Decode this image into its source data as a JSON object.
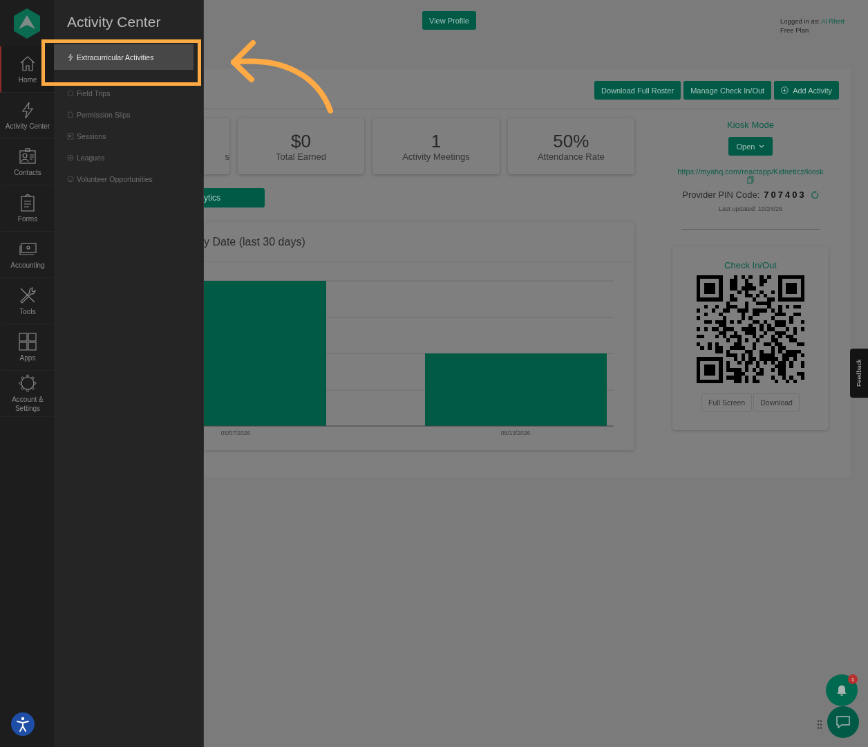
{
  "rail": {
    "items": [
      {
        "label": "Home",
        "kind": "home",
        "selected": true
      },
      {
        "label": "Activity Center",
        "kind": "bolt",
        "selected": false
      },
      {
        "label": "Contacts",
        "kind": "contact",
        "selected": false
      },
      {
        "label": "Forms",
        "kind": "clipboard",
        "selected": false
      },
      {
        "label": "Accounting",
        "kind": "money",
        "selected": false
      },
      {
        "label": "Tools",
        "kind": "tools",
        "selected": false
      },
      {
        "label": "Apps",
        "kind": "apps",
        "selected": false
      },
      {
        "label": "Account & Settings",
        "kind": "gear",
        "selected": false
      }
    ]
  },
  "flyout": {
    "title": "Activity Center",
    "items": [
      {
        "label": "Extracurricular Activities",
        "kind": "bolt",
        "selected": true
      },
      {
        "label": "Field Trips",
        "kind": "circle",
        "selected": false
      },
      {
        "label": "Permission Slips",
        "kind": "file",
        "selected": false
      },
      {
        "label": "Sessions",
        "kind": "square",
        "selected": false
      },
      {
        "label": "Leagues",
        "kind": "globe",
        "selected": false
      },
      {
        "label": "Volunteer Opportunities",
        "kind": "smile",
        "selected": false
      }
    ]
  },
  "header": {
    "view_profile": "View Profile",
    "logged_in_label": "Logged in as:",
    "user": "Al Rhett",
    "plan": "Free Plan"
  },
  "actions": [
    {
      "label": "Download Full Roster",
      "kind": "plain"
    },
    {
      "label": "Manage Check In/Out",
      "kind": "plain"
    },
    {
      "label": "Add Activity",
      "kind": "add"
    }
  ],
  "stats": [
    {
      "label": "s"
    },
    {
      "value": "$0",
      "label": "Total Earned"
    },
    {
      "value": "1",
      "label": "Activity Meetings"
    },
    {
      "value": "50%",
      "label": "Attendance Rate"
    }
  ],
  "analytics_button": "ytics",
  "chart_card": {
    "title": "y Date (last 30 days)",
    "x_labels": [
      "05/07/2026",
      "05/13/2026"
    ]
  },
  "kiosk": {
    "title": "Kiosk Mode",
    "open_button": "Open",
    "url": "https://myahq.com/reactapp/Kidneticz/kiosk",
    "pin_label": "Provider PIN Code:",
    "pin": "707403",
    "last_updated": "Last updated: 10/24/25"
  },
  "check_in": {
    "title": "Check In/Out",
    "buttons": [
      "Full Screen",
      "Download"
    ]
  },
  "feedback": "Feedback",
  "notifications": {
    "count": "1"
  }
}
